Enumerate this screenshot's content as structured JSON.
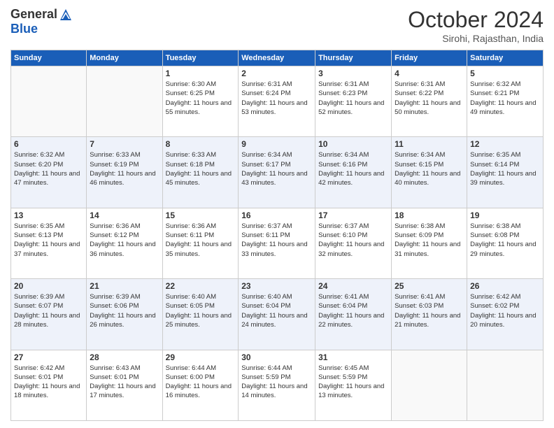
{
  "header": {
    "logo": {
      "general": "General",
      "blue": "Blue"
    },
    "title": "October 2024",
    "subtitle": "Sirohi, Rajasthan, India"
  },
  "days_of_week": [
    "Sunday",
    "Monday",
    "Tuesday",
    "Wednesday",
    "Thursday",
    "Friday",
    "Saturday"
  ],
  "weeks": [
    [
      {
        "day": "",
        "info": ""
      },
      {
        "day": "",
        "info": ""
      },
      {
        "day": "1",
        "info": "Sunrise: 6:30 AM\nSunset: 6:25 PM\nDaylight: 11 hours and 55 minutes."
      },
      {
        "day": "2",
        "info": "Sunrise: 6:31 AM\nSunset: 6:24 PM\nDaylight: 11 hours and 53 minutes."
      },
      {
        "day": "3",
        "info": "Sunrise: 6:31 AM\nSunset: 6:23 PM\nDaylight: 11 hours and 52 minutes."
      },
      {
        "day": "4",
        "info": "Sunrise: 6:31 AM\nSunset: 6:22 PM\nDaylight: 11 hours and 50 minutes."
      },
      {
        "day": "5",
        "info": "Sunrise: 6:32 AM\nSunset: 6:21 PM\nDaylight: 11 hours and 49 minutes."
      }
    ],
    [
      {
        "day": "6",
        "info": "Sunrise: 6:32 AM\nSunset: 6:20 PM\nDaylight: 11 hours and 47 minutes."
      },
      {
        "day": "7",
        "info": "Sunrise: 6:33 AM\nSunset: 6:19 PM\nDaylight: 11 hours and 46 minutes."
      },
      {
        "day": "8",
        "info": "Sunrise: 6:33 AM\nSunset: 6:18 PM\nDaylight: 11 hours and 45 minutes."
      },
      {
        "day": "9",
        "info": "Sunrise: 6:34 AM\nSunset: 6:17 PM\nDaylight: 11 hours and 43 minutes."
      },
      {
        "day": "10",
        "info": "Sunrise: 6:34 AM\nSunset: 6:16 PM\nDaylight: 11 hours and 42 minutes."
      },
      {
        "day": "11",
        "info": "Sunrise: 6:34 AM\nSunset: 6:15 PM\nDaylight: 11 hours and 40 minutes."
      },
      {
        "day": "12",
        "info": "Sunrise: 6:35 AM\nSunset: 6:14 PM\nDaylight: 11 hours and 39 minutes."
      }
    ],
    [
      {
        "day": "13",
        "info": "Sunrise: 6:35 AM\nSunset: 6:13 PM\nDaylight: 11 hours and 37 minutes."
      },
      {
        "day": "14",
        "info": "Sunrise: 6:36 AM\nSunset: 6:12 PM\nDaylight: 11 hours and 36 minutes."
      },
      {
        "day": "15",
        "info": "Sunrise: 6:36 AM\nSunset: 6:11 PM\nDaylight: 11 hours and 35 minutes."
      },
      {
        "day": "16",
        "info": "Sunrise: 6:37 AM\nSunset: 6:11 PM\nDaylight: 11 hours and 33 minutes."
      },
      {
        "day": "17",
        "info": "Sunrise: 6:37 AM\nSunset: 6:10 PM\nDaylight: 11 hours and 32 minutes."
      },
      {
        "day": "18",
        "info": "Sunrise: 6:38 AM\nSunset: 6:09 PM\nDaylight: 11 hours and 31 minutes."
      },
      {
        "day": "19",
        "info": "Sunrise: 6:38 AM\nSunset: 6:08 PM\nDaylight: 11 hours and 29 minutes."
      }
    ],
    [
      {
        "day": "20",
        "info": "Sunrise: 6:39 AM\nSunset: 6:07 PM\nDaylight: 11 hours and 28 minutes."
      },
      {
        "day": "21",
        "info": "Sunrise: 6:39 AM\nSunset: 6:06 PM\nDaylight: 11 hours and 26 minutes."
      },
      {
        "day": "22",
        "info": "Sunrise: 6:40 AM\nSunset: 6:05 PM\nDaylight: 11 hours and 25 minutes."
      },
      {
        "day": "23",
        "info": "Sunrise: 6:40 AM\nSunset: 6:04 PM\nDaylight: 11 hours and 24 minutes."
      },
      {
        "day": "24",
        "info": "Sunrise: 6:41 AM\nSunset: 6:04 PM\nDaylight: 11 hours and 22 minutes."
      },
      {
        "day": "25",
        "info": "Sunrise: 6:41 AM\nSunset: 6:03 PM\nDaylight: 11 hours and 21 minutes."
      },
      {
        "day": "26",
        "info": "Sunrise: 6:42 AM\nSunset: 6:02 PM\nDaylight: 11 hours and 20 minutes."
      }
    ],
    [
      {
        "day": "27",
        "info": "Sunrise: 6:42 AM\nSunset: 6:01 PM\nDaylight: 11 hours and 18 minutes."
      },
      {
        "day": "28",
        "info": "Sunrise: 6:43 AM\nSunset: 6:01 PM\nDaylight: 11 hours and 17 minutes."
      },
      {
        "day": "29",
        "info": "Sunrise: 6:44 AM\nSunset: 6:00 PM\nDaylight: 11 hours and 16 minutes."
      },
      {
        "day": "30",
        "info": "Sunrise: 6:44 AM\nSunset: 5:59 PM\nDaylight: 11 hours and 14 minutes."
      },
      {
        "day": "31",
        "info": "Sunrise: 6:45 AM\nSunset: 5:59 PM\nDaylight: 11 hours and 13 minutes."
      },
      {
        "day": "",
        "info": ""
      },
      {
        "day": "",
        "info": ""
      }
    ]
  ]
}
